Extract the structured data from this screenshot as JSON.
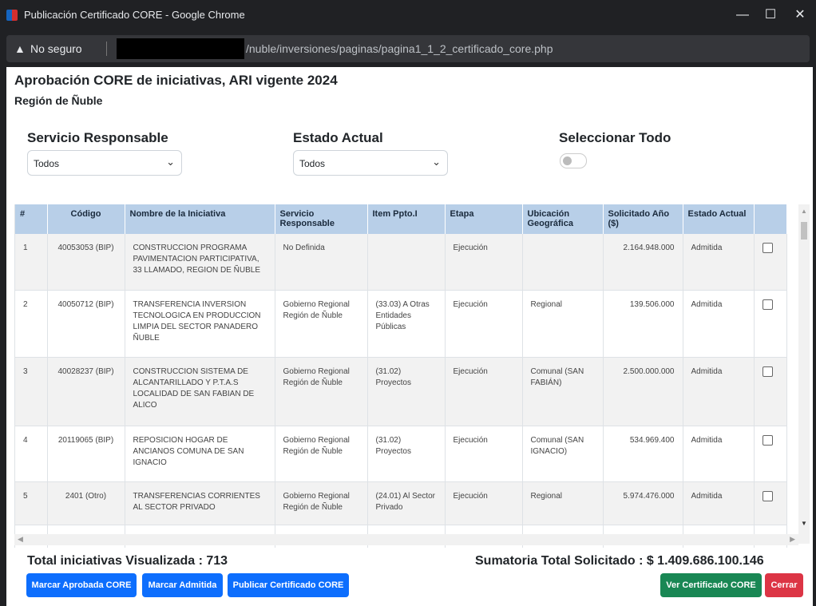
{
  "window": {
    "title": "Publicación Certificado CORE - Google Chrome",
    "minimize": "—",
    "maximize": "☐",
    "close": "✕"
  },
  "address": {
    "warning_icon": "▲",
    "security": "No seguro",
    "url_path": "/nuble/inversiones/paginas/pagina1_1_2_certificado_core.php"
  },
  "page": {
    "title": "Aprobación CORE de iniciativas, ARI vigente 2024",
    "subtitle": "Región de Ñuble"
  },
  "filters": {
    "servicio_label": "Servicio Responsable",
    "servicio_value": "Todos",
    "estado_label": "Estado Actual",
    "estado_value": "Todos",
    "select_all_label": "Seleccionar Todo",
    "chevron": "⌄"
  },
  "table": {
    "headers": [
      "#",
      "Código",
      "Nombre de la Iniciativa",
      "Servicio Responsable",
      "Item Ppto.I",
      "Etapa",
      "Ubicación Geográfica",
      "Solicitado Año ($)",
      "Estado Actual",
      ""
    ],
    "rows": [
      {
        "n": "1",
        "codigo": "40053053 (BIP)",
        "nombre": "CONSTRUCCION PROGRAMA PAVIMENTACION PARTICIPATIVA, 33 LLAMADO, REGION DE ÑUBLE",
        "servicio": "No Definida",
        "item": "",
        "etapa": "Ejecución",
        "ubicacion": "",
        "solicitado": "2.164.948.000",
        "estado": "Admitida"
      },
      {
        "n": "2",
        "codigo": "40050712 (BIP)",
        "nombre": "TRANSFERENCIA INVERSION TECNOLOGICA EN PRODUCCION LIMPIA DEL SECTOR PANADERO ÑUBLE",
        "servicio": "Gobierno Regional Región de Ñuble",
        "item": "(33.03) A Otras Entidades Públicas",
        "etapa": "Ejecución",
        "ubicacion": "Regional",
        "solicitado": "139.506.000",
        "estado": "Admitida"
      },
      {
        "n": "3",
        "codigo": "40028237 (BIP)",
        "nombre": "CONSTRUCCION SISTEMA DE ALCANTARILLADO Y P.T.A.S LOCALIDAD DE SAN FABIAN DE ALICO",
        "servicio": "Gobierno Regional Región de Ñuble",
        "item": "(31.02) Proyectos",
        "etapa": "Ejecución",
        "ubicacion": "Comunal (SAN FABIÁN)",
        "solicitado": "2.500.000.000",
        "estado": "Admitida"
      },
      {
        "n": "4",
        "codigo": "20119065 (BIP)",
        "nombre": "REPOSICION HOGAR DE ANCIANOS COMUNA DE SAN IGNACIO",
        "servicio": "Gobierno Regional Región de Ñuble",
        "item": "(31.02) Proyectos",
        "etapa": "Ejecución",
        "ubicacion": "Comunal (SAN IGNACIO)",
        "solicitado": "534.969.400",
        "estado": "Admitida"
      },
      {
        "n": "5",
        "codigo": "2401 (Otro)",
        "nombre": "TRANSFERENCIAS CORRIENTES AL SECTOR PRIVADO",
        "servicio": "Gobierno Regional Región de Ñuble",
        "item": "(24.01) Al Sector Privado",
        "etapa": "Ejecución",
        "ubicacion": "Regional",
        "solicitado": "5.974.476.000",
        "estado": "Admitida"
      }
    ]
  },
  "scroll": {
    "up": "▲",
    "down": "▼",
    "left": "◀",
    "right": "▶"
  },
  "footer": {
    "total_label": "Total iniciativas Visualizada : 713",
    "sum_label": "Sumatoria Total Solicitado : $ 1.409.686.100.146",
    "btn_aprobada": "Marcar Aprobada CORE",
    "btn_admitida": "Marcar Admitida",
    "btn_publicar": "Publicar Certificado CORE",
    "btn_ver": "Ver Certificado CORE",
    "btn_cerrar": "Cerrar"
  }
}
